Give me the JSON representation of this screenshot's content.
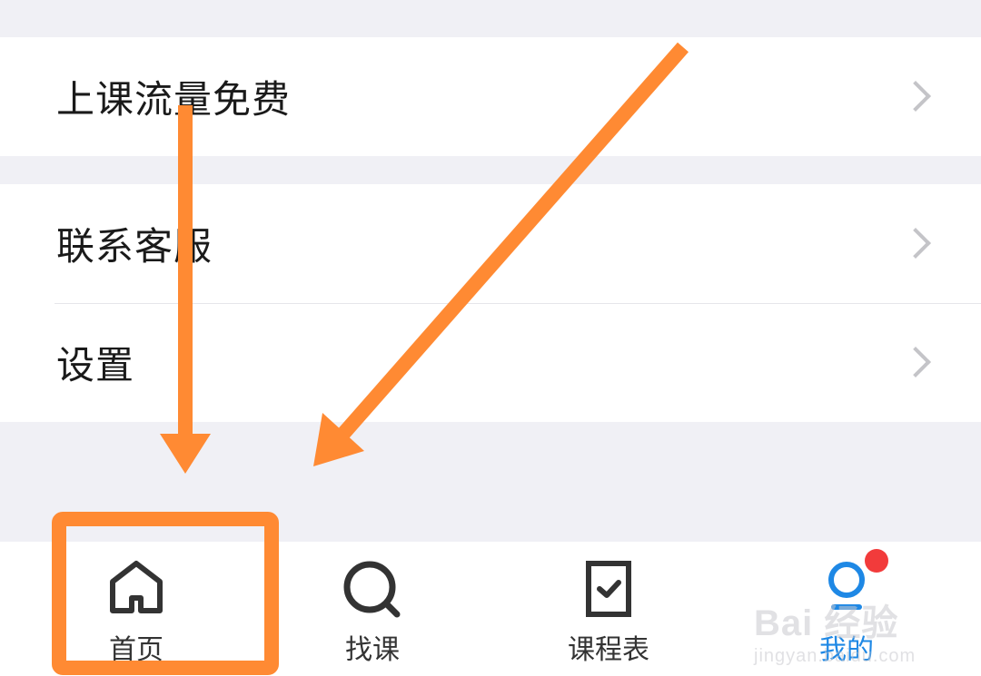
{
  "menu": {
    "group1": [
      {
        "label": "上课流量免费"
      }
    ],
    "group2": [
      {
        "label": "联系客服"
      },
      {
        "label": "设置"
      }
    ]
  },
  "tabbar": {
    "tabs": [
      {
        "label": "首页",
        "icon": "home-icon",
        "active": false
      },
      {
        "label": "找课",
        "icon": "search-icon",
        "active": false
      },
      {
        "label": "课程表",
        "icon": "schedule-icon",
        "active": false
      },
      {
        "label": "我的",
        "icon": "profile-icon",
        "active": true
      }
    ],
    "badge_color": "#f23b3b"
  },
  "annotation": {
    "color": "#ff8a33"
  },
  "watermark": {
    "brand": "Bai 经验",
    "site": "jingyan.baidu.com"
  },
  "colors": {
    "background": "#f0f0f5",
    "active_tab": "#1e88e5",
    "text": "#1a1a1a"
  }
}
